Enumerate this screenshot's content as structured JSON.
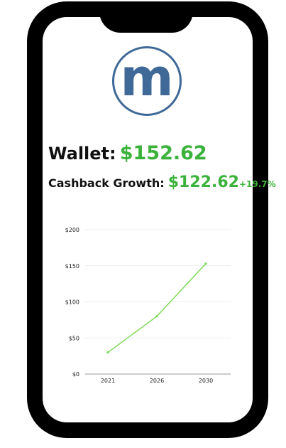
{
  "logo": {
    "letter": "m",
    "color": "#3f6996"
  },
  "wallet": {
    "label": "Wallet:",
    "value": "$152.62"
  },
  "growth": {
    "label": "Cashback Growth:",
    "value": "$122.62",
    "percent": "+19.7%"
  },
  "colors": {
    "accent": "#3bb23b",
    "line": "#7ed957"
  },
  "chart_data": {
    "type": "line",
    "title": "",
    "xlabel": "",
    "ylabel": "",
    "x": [
      "2021",
      "2026",
      "2030"
    ],
    "series": [
      {
        "values": [
          30,
          80,
          153
        ]
      }
    ],
    "yticks": [
      "$0",
      "$50",
      "$100",
      "$150",
      "$200"
    ],
    "ylim": [
      0,
      200
    ],
    "grid": true,
    "legend": "none"
  }
}
